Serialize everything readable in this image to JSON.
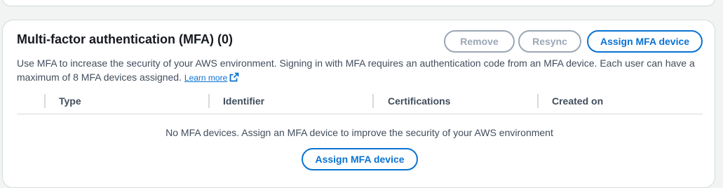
{
  "mfa": {
    "title": "Multi-factor authentication (MFA) (0)",
    "buttons": {
      "remove": "Remove",
      "resync": "Resync",
      "assign": "Assign MFA device"
    },
    "description": "Use MFA to increase the security of your AWS environment. Signing in with MFA requires an authentication code from an MFA device. Each user can have a maximum of 8 MFA devices assigned.",
    "learn_more": "Learn more",
    "columns": [
      "Type",
      "Identifier",
      "Certifications",
      "Created on"
    ],
    "empty_message": "No MFA devices. Assign an MFA device to improve the security of your AWS environment",
    "empty_button": "Assign MFA device"
  },
  "colors": {
    "accent": "#0972d3",
    "disabled": "#9ba7b6",
    "border": "#d5dbdb",
    "text": "#16191f",
    "secondary_text": "#414d5c"
  }
}
